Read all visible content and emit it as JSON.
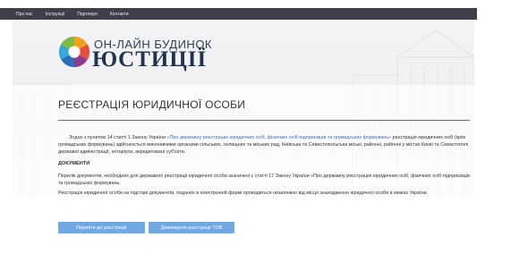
{
  "nav": {
    "items": [
      "Про нас",
      "Інструкції",
      "Партнери",
      "Контакти"
    ]
  },
  "brand": {
    "line1": "ОН-ЛАЙН БУДИНОК",
    "line2": "ЮСТИЦІЇ"
  },
  "page": {
    "title": "РЕЄСТРАЦІЯ ЮРИДИЧНОЇ ОСОБИ",
    "p1_prefix": "Згідно з пунктом 14  статті 1 Закону України",
    "p1_link": "«Про державну реєстрацію юридичних осіб, фізичних осіб-підприємців та громадських формувань»",
    "p1_suffix": "реєстрація юридичних осіб (крім громадських формувань) здійснюється виконавчими органами сільських, селищних та міських рад, Київська та Севастопольська міські, районні, районні у містах Києві та Севастополі державні адміністрації, нотаріуси, акредитовані суб'єкти.",
    "documents_heading": "ДОКУМЕНТИ",
    "p2": "Перелік документів, необхідних для державної реєстрації юридичної особи зазначені у статті 17 Закону України «Про державну реєстрацію юридичних осіб, фізичних осіб-підприємців та громадських формувань.",
    "p3": "Реєстрація  юридичної особи на підставі документів, поданих в електронній формі  проводиться незалежно від місця знаходження юридичної особи в межах України."
  },
  "buttons": {
    "go_registration": "Перейти до реєстрації",
    "demo": "Демоверсія реєстрації ТОВ"
  },
  "colors": {
    "nav_bg": "#413e49",
    "link": "#3f6fb0",
    "button": "#72a8e0",
    "brand": "#1f3250"
  }
}
